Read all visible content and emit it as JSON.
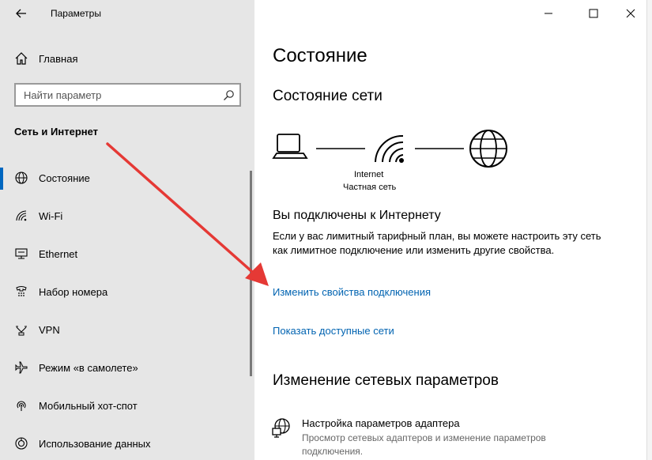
{
  "window": {
    "title": "Параметры",
    "controls": [
      "minimize-icon",
      "maximize-icon",
      "close-icon"
    ]
  },
  "sidebar": {
    "home_label": "Главная",
    "search_placeholder": "Найти параметр",
    "section_label": "Сеть и Интернет",
    "items": [
      {
        "label": "Состояние",
        "icon": "globe-icon",
        "active": true
      },
      {
        "label": "Wi-Fi",
        "icon": "wifi-icon",
        "active": false
      },
      {
        "label": "Ethernet",
        "icon": "ethernet-icon",
        "active": false
      },
      {
        "label": "Набор номера",
        "icon": "dialup-icon",
        "active": false
      },
      {
        "label": "VPN",
        "icon": "vpn-icon",
        "active": false
      },
      {
        "label": "Режим «в самолете»",
        "icon": "airplane-icon",
        "active": false
      },
      {
        "label": "Мобильный хот-спот",
        "icon": "hotspot-icon",
        "active": false
      },
      {
        "label": "Использование данных",
        "icon": "data-usage-icon",
        "active": false
      }
    ]
  },
  "main": {
    "title": "Состояние",
    "network_status_title": "Состояние сети",
    "diagram": {
      "network_name": "Internet",
      "network_type": "Частная сеть"
    },
    "connected_title": "Вы подключены к Интернету",
    "connected_desc": "Если у вас лимитный тарифный план, вы можете настроить эту сеть как лимитное подключение или изменить другие свойства.",
    "link_change_properties": "Изменить свойства подключения",
    "link_show_networks": "Показать доступные сети",
    "change_settings_title": "Изменение сетевых параметров",
    "adapter_title": "Настройка параметров адаптера",
    "adapter_desc": "Просмотр сетевых адаптеров и изменение параметров подключения."
  },
  "colors": {
    "accent": "#0067c0",
    "link": "#0063b1",
    "sidebar_bg": "#e6e6e6",
    "annotation": "#e53935"
  }
}
